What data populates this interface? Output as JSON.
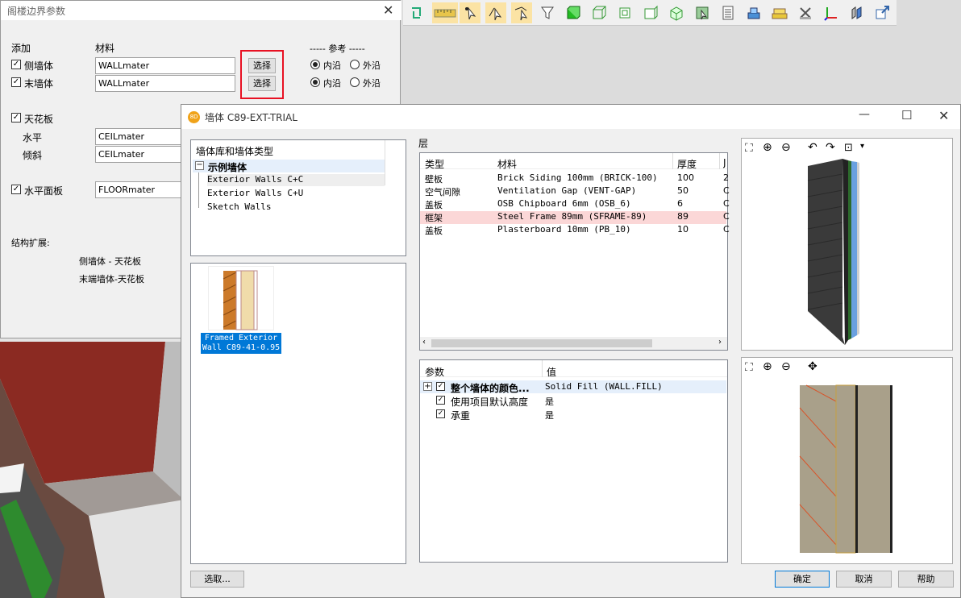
{
  "back_dialog": {
    "title": "阁楼边界参数",
    "col_add": "添加",
    "col_material": "材料",
    "ref_label": "----- 参考 -----",
    "side_wall": {
      "label": "侧墙体",
      "checked": true,
      "material": "WALLmater",
      "btn": "选择",
      "inner": "内沿",
      "outer": "外沿"
    },
    "end_wall": {
      "label": "末墙体",
      "checked": true,
      "material": "WALLmater",
      "btn": "选择",
      "inner": "内沿",
      "outer": "外沿"
    },
    "ceiling": {
      "label": "天花板",
      "checked": true
    },
    "horizontal": {
      "label": "水平",
      "material": "CEILmater"
    },
    "slope": {
      "label": "倾斜",
      "material": "CEILmater"
    },
    "floor": {
      "label": "水平面板",
      "checked": true,
      "material": "FLOORmater"
    },
    "struct_ext": "结构扩展:",
    "struct_1": "侧墙体 - 天花板",
    "struct_2": "末端墙体-天花板"
  },
  "main_dialog": {
    "title": "墙体 C89-EXT-TRIAL",
    "tree": {
      "header": "墙体库和墙体类型",
      "root": "示例墙体",
      "items": [
        "Exterior Walls C+C",
        "Exterior Walls C+U",
        "Sketch Walls"
      ]
    },
    "preview_label": "Framed Exterior Wall C89-41-0.95",
    "layers": {
      "title": "层",
      "headers": [
        "类型",
        "材料",
        "厚度",
        "J"
      ],
      "rows": [
        {
          "type": "壁板",
          "material": "Brick Siding 100mm (BRICK-100)",
          "thickness": "100",
          "extra": "2"
        },
        {
          "type": "空气间隙",
          "material": "Ventilation Gap (VENT-GAP)",
          "thickness": "50",
          "extra": "C"
        },
        {
          "type": "盖板",
          "material": "OSB Chipboard 6mm (OSB_6)",
          "thickness": "6",
          "extra": "C"
        },
        {
          "type": "框架",
          "material": "Steel Frame 89mm (SFRAME-89)",
          "thickness": "89",
          "extra": "C"
        },
        {
          "type": "盖板",
          "material": "Plasterboard 10mm (PB_10)",
          "thickness": "10",
          "extra": "C"
        }
      ],
      "highlight_row": 3
    },
    "params": {
      "headers": [
        "参数",
        "值"
      ],
      "rows": [
        {
          "name": "整个墙体的颜色...",
          "value": "Solid Fill  (WALL.FILL)",
          "expand": "+"
        },
        {
          "name": "使用项目默认高度",
          "value": "是"
        },
        {
          "name": "承重",
          "value": "是"
        }
      ]
    },
    "buttons": {
      "select": "选取...",
      "ok": "确定",
      "cancel": "取消",
      "help": "帮助"
    },
    "window_controls": {
      "minimize": "—",
      "maximize": "☐",
      "close": "✕"
    }
  },
  "colors": {
    "accent_blue": "#0078d7",
    "highlight_row": "#fbd7d7",
    "red_frame": "#e81123"
  }
}
